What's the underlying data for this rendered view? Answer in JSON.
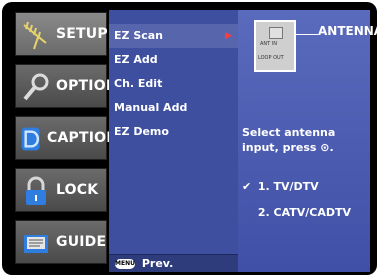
{
  "sidebar": {
    "items": [
      {
        "label": "SETUP",
        "icon": "antenna-icon",
        "active": true
      },
      {
        "label": "OPTION",
        "icon": "magnifier-icon",
        "active": false
      },
      {
        "label": "CAPTION",
        "icon": "caption-d-icon",
        "active": false
      },
      {
        "label": "LOCK",
        "icon": "padlock-icon",
        "active": false
      },
      {
        "label": "GUIDE",
        "icon": "guide-book-icon",
        "active": false
      }
    ]
  },
  "submenu": {
    "items": [
      {
        "label": "EZ Scan",
        "selected": true
      },
      {
        "label": "EZ Add"
      },
      {
        "label": "Ch. Edit"
      },
      {
        "label": "Manual Add"
      },
      {
        "label": "EZ Demo"
      }
    ],
    "bottom": {
      "menu_button": "MENU",
      "label": "Prev."
    }
  },
  "panel": {
    "antenna": {
      "label": "ANTENNA",
      "port_in": "ANT IN",
      "port_loop": "LOOP OUT"
    },
    "instruction": "Select antenna input, press ⊙.",
    "options": [
      {
        "label": "1. TV/DTV",
        "checked": true
      },
      {
        "label": "2. CATV/CADTV",
        "checked": false
      }
    ],
    "check_glyph": "✔"
  },
  "colors": {
    "submenu_bg": "#3e4fa0",
    "panel_bg": "#4f5fb6",
    "accent_arrow": "#ff3c3c"
  }
}
